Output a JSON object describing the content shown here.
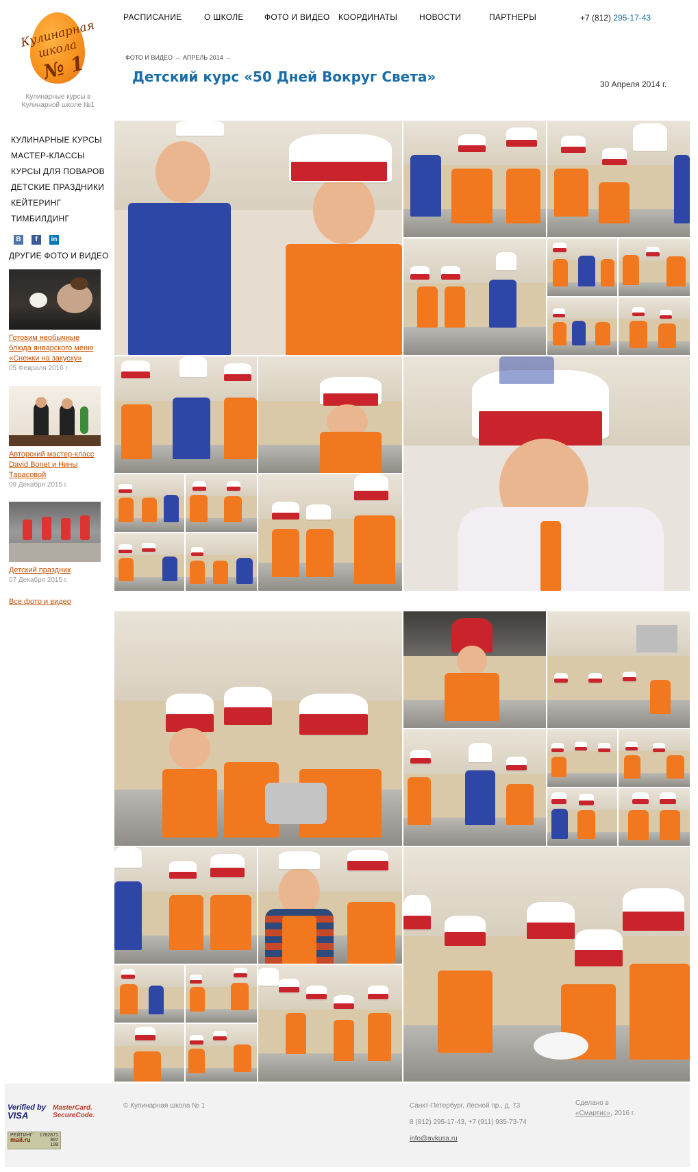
{
  "site": {
    "logo_line1": "Кулинарная",
    "logo_line2": "школа",
    "logo_line3": "№ 1",
    "tagline": "Кулинарные курсы в Кулинарной школе №1"
  },
  "topnav": {
    "items": [
      "РАСПИСАНИЕ",
      "О ШКОЛЕ",
      "ФОТО И ВИДЕО",
      "КООРДИНАТЫ",
      "НОВОСТИ",
      "ПАРТНЕРЫ"
    ],
    "phone_prefix": "+7 (812) ",
    "phone_number": "295-17-43"
  },
  "sidebar": {
    "menu": [
      "КУЛИНАРНЫЕ КУРСЫ",
      "МАСТЕР-КЛАССЫ",
      "КУРСЫ ДЛЯ ПОВАРОВ",
      "ДЕТСКИЕ ПРАЗДНИКИ",
      "КЕЙТЕРИНГ",
      "ТИМБИЛДИНГ"
    ],
    "social": [
      "В",
      "f",
      "in"
    ],
    "other_title": "ДРУГИЕ ФОТО И ВИДЕО",
    "items": [
      {
        "title": "Готовим необычные блюда январского меню «Снежки на закуску»",
        "date": "05 Февраля 2016 г."
      },
      {
        "title": "Авторский мастер-класс David Bonet и Нины Тарасовой",
        "date": "09 Декабря 2015 г."
      },
      {
        "title": "Детский праздник",
        "date": "07 Декабря 2015 г."
      }
    ],
    "all_link": "Все фото и видео"
  },
  "breadcrumb": {
    "level1": "ФОТО И ВИДЕО",
    "level2": "АПРЕЛЬ 2014",
    "arrow": "→"
  },
  "page": {
    "title": "Детский курс «50 Дней Вокруг Света»",
    "date": "30 Апреля 2014 г."
  },
  "footer": {
    "visa_line1": "Verified by",
    "visa_line2": "VISA",
    "mc_line1": "MasterCard.",
    "mc_line2": "SecureCode.",
    "counter_label": "РЕЙТИНГ",
    "counter_site": "mail.ru",
    "counter_v1": "1782871",
    "counter_v2": "897",
    "counter_v3": "199",
    "copyright": "© Кулинарная школа № 1",
    "address": "Санкт-Петербург, Лесной пр., д. 73",
    "phones": "8 (812) 295-17-43, +7 (911) 935-73-74",
    "email": "info@avkusa.ru",
    "made_prefix": "Сделано в",
    "made_link": "«Смартис»",
    "made_suffix": ", 2016 г."
  },
  "colors": {
    "accent": "#1a6da8",
    "link": "#c54e00",
    "apron": "#f2781f",
    "hat_band": "#c9242b"
  }
}
